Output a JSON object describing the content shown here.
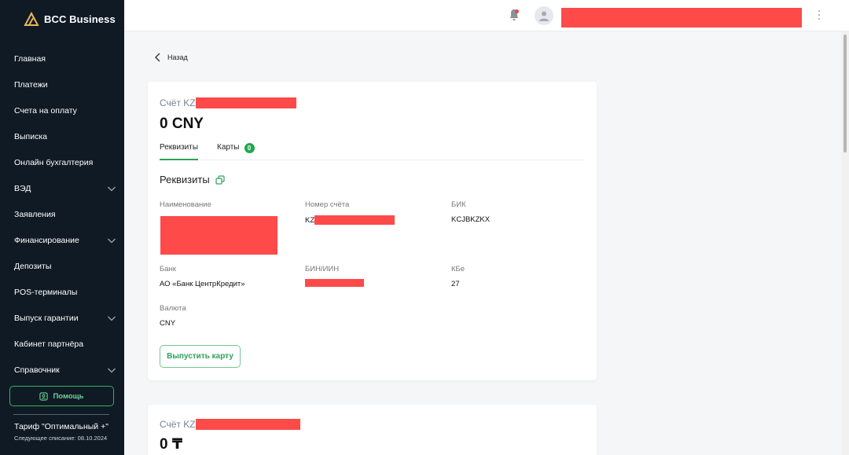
{
  "app": {
    "logo_text": "BCC Business"
  },
  "sidebar": {
    "items": [
      {
        "label": "Главная",
        "has_chevron": false
      },
      {
        "label": "Платежи",
        "has_chevron": false
      },
      {
        "label": "Счета на оплату",
        "has_chevron": false
      },
      {
        "label": "Выписка",
        "has_chevron": false
      },
      {
        "label": "Онлайн бухгалтерия",
        "has_chevron": false
      },
      {
        "label": "ВЭД",
        "has_chevron": true
      },
      {
        "label": "Заявления",
        "has_chevron": false
      },
      {
        "label": "Финансирование",
        "has_chevron": true
      },
      {
        "label": "Депозиты",
        "has_chevron": false
      },
      {
        "label": "POS-терминалы",
        "has_chevron": false
      },
      {
        "label": "Выпуск гарантии",
        "has_chevron": true
      },
      {
        "label": "Кабинет партнёра",
        "has_chevron": false
      },
      {
        "label": "Справочник",
        "has_chevron": true
      }
    ],
    "help_label": "Помощь",
    "tariff_title": "Тариф \"Оптимальный +\"",
    "tariff_sub": "Следующее списание: 08.10.2024"
  },
  "header": {
    "notification_dot": true
  },
  "main": {
    "back_label": "Назад",
    "account1": {
      "label_prefix": "Счёт KZ",
      "balance": "0 CNY",
      "tabs": [
        {
          "label": "Реквизиты",
          "active": true
        },
        {
          "label": "Карты",
          "badge": "0"
        }
      ],
      "requisites_title": "Реквизиты",
      "fields": {
        "name_label": "Наименование",
        "account_label": "Номер счёта",
        "account_prefix": "KZ",
        "bik_label": "БИК",
        "bik_value": "KCJBKZKX",
        "bank_label": "Банк",
        "bank_value": "АО «Банк ЦентрКредит»",
        "bin_label": "БИН/ИИН",
        "kbe_label": "КБе",
        "kbe_value": "27",
        "currency_label": "Валюта",
        "currency_value": "CNY"
      },
      "issue_card_button": "Выпустить карту"
    },
    "account2": {
      "label_prefix": "Счёт KZ",
      "balance": "0 ₸"
    }
  },
  "colors": {
    "sidebar_bg": "#0f1a24",
    "accent_green": "#2fa05a",
    "redaction": "#ff4a4a"
  }
}
